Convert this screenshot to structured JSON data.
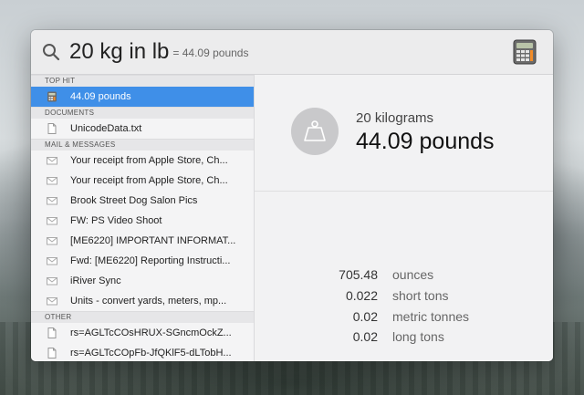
{
  "search": {
    "query": "20 kg in lb",
    "inline_result": "= 44.09 pounds"
  },
  "sidebar": {
    "sections": [
      {
        "header": "TOP HIT",
        "items": [
          {
            "label": "44.09 pounds",
            "icon": "calculator-icon",
            "selected": true
          }
        ]
      },
      {
        "header": "DOCUMENTS",
        "items": [
          {
            "label": "UnicodeData.txt",
            "icon": "document-icon"
          }
        ]
      },
      {
        "header": "MAIL & MESSAGES",
        "items": [
          {
            "label": "Your receipt from Apple Store, Ch...",
            "icon": "envelope-icon"
          },
          {
            "label": "Your receipt from Apple Store, Ch...",
            "icon": "envelope-icon"
          },
          {
            "label": "Brook Street Dog Salon Pics",
            "icon": "envelope-icon"
          },
          {
            "label": "FW: PS Video Shoot",
            "icon": "envelope-icon"
          },
          {
            "label": "[ME6220] IMPORTANT INFORMAT...",
            "icon": "envelope-icon"
          },
          {
            "label": "Fwd: [ME6220] Reporting Instructi...",
            "icon": "envelope-icon"
          },
          {
            "label": "iRiver Sync",
            "icon": "envelope-icon"
          },
          {
            "label": "Units - convert yards, meters, mp...",
            "icon": "envelope-icon"
          }
        ]
      },
      {
        "header": "OTHER",
        "items": [
          {
            "label": "rs=AGLTcCOsHRUX-SGncmOckZ...",
            "icon": "document-icon"
          },
          {
            "label": "rs=AGLTcCOpFb-JfQKlF5-dLTobH...",
            "icon": "document-icon"
          }
        ]
      }
    ]
  },
  "preview": {
    "icon": "scale-icon",
    "from_label": "20 kilograms",
    "result": "44.09 pounds",
    "conversions": [
      {
        "value": "705.48",
        "unit": "ounces"
      },
      {
        "value": "0.022",
        "unit": "short tons"
      },
      {
        "value": "0.02",
        "unit": "metric tonnes"
      },
      {
        "value": "0.02",
        "unit": "long tons"
      }
    ]
  },
  "colors": {
    "selection": "#3f8fe8",
    "window_bg": "#f2f2f3"
  }
}
